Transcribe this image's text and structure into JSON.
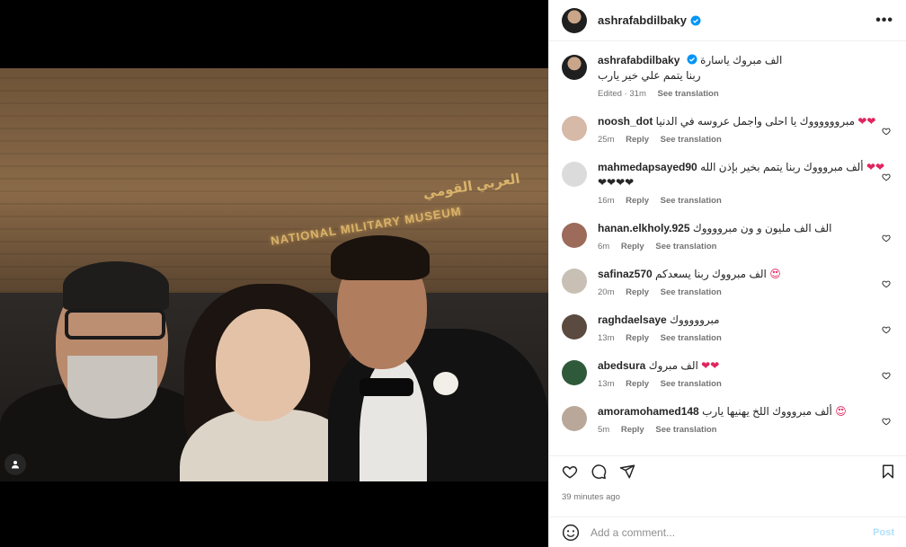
{
  "media": {
    "sign_text": "NATIONAL MILITARY MUSEUM",
    "sign_text_ar": "العربي القومي"
  },
  "header": {
    "username": "ashrafabdilbaky",
    "more_label": "•••"
  },
  "caption": {
    "username": "ashrafabdilbaky",
    "text_line1": "الف مبروك ياسارة",
    "text_line2": "ربنا يتمم علي خير يارب",
    "edited": "Edited",
    "time": "31m",
    "see_translation": "See translation"
  },
  "comments": [
    {
      "username": "noosh_dot",
      "text": "مبرووووووك يا احلى واجمل عروسه في الدنيا",
      "hearts": "❤❤",
      "time": "25m",
      "reply": "Reply",
      "see_translation": "See translation",
      "avatar_color": "#d7b9a8"
    },
    {
      "username": "mahmedapsayed90",
      "text": "ألف مبروووك ربنا يتمم بخير بإذن الله",
      "hearts": "❤❤",
      "hearts2": "❤❤❤❤",
      "time": "16m",
      "reply": "Reply",
      "see_translation": "See translation",
      "avatar_color": "#dbdbdb"
    },
    {
      "username": "hanan.elkholy.925",
      "text": "الف الف مليون و ون مبرووووك",
      "hearts": "",
      "time": "6m",
      "reply": "Reply",
      "see_translation": "See translation",
      "avatar_color": "#9c6b5a"
    },
    {
      "username": "safinaz570",
      "text": "الف مبرووك ربنا يسعدكم",
      "hearts": "😍",
      "time": "20m",
      "reply": "Reply",
      "see_translation": "See translation",
      "avatar_color": "#c8c0b4"
    },
    {
      "username": "raghdaelsaye",
      "text": "مبروووووك",
      "hearts": "",
      "time": "13m",
      "reply": "Reply",
      "see_translation": "See translation",
      "avatar_color": "#5b4a3f"
    },
    {
      "username": "abedsura",
      "text": "الف مبروك",
      "hearts": "❤❤",
      "time": "13m",
      "reply": "Reply",
      "see_translation": "See translation",
      "avatar_color": "#2f5a3a"
    },
    {
      "username": "amoramohamed148",
      "text": "ألف مبروووك اللخ يهنيها يارب",
      "hearts": "😍",
      "time": "5m",
      "reply": "Reply",
      "see_translation": "See translation",
      "avatar_color": "#b9a89a"
    }
  ],
  "actions": {
    "time_ago": "39 minutes ago"
  },
  "add_comment": {
    "placeholder": "Add a comment...",
    "post_label": "Post"
  },
  "colors": {
    "verified": "#0095f6",
    "heart": "#e0245e",
    "meta": "#737373"
  }
}
